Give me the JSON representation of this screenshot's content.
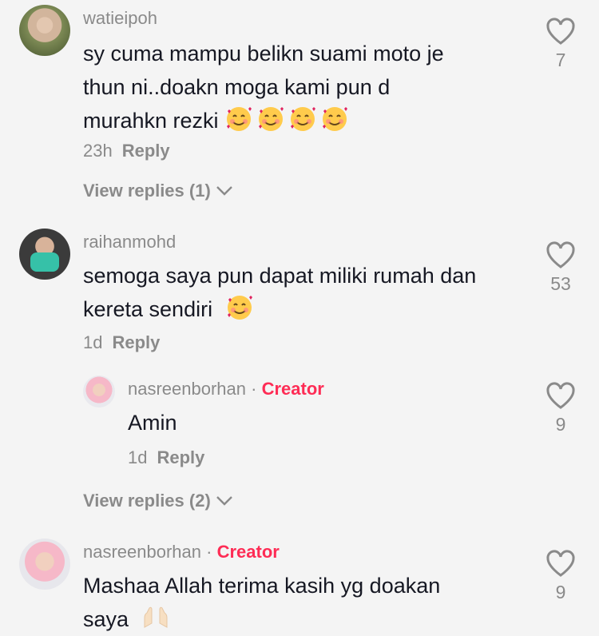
{
  "comments": [
    {
      "username": "watieipoh",
      "text_lines": [
        "sy cuma mampu belikn suami moto je",
        "thun ni..doakn moga kami pun d",
        "murahkn rezki"
      ],
      "time": "23h",
      "reply_label": "Reply",
      "likes": "7",
      "view_replies": "View replies (1)"
    },
    {
      "username": "raihanmohd",
      "text_lines": [
        "semoga saya pun dapat miliki rumah dan",
        "kereta sendiri"
      ],
      "time": "1d",
      "reply_label": "Reply",
      "likes": "53",
      "reply": {
        "username": "nasreenborhan",
        "separator": "·",
        "badge": "Creator",
        "text": "Amin",
        "time": "1d",
        "reply_label": "Reply",
        "likes": "9"
      },
      "view_replies": "View replies (2)"
    },
    {
      "username": "nasreenborhan",
      "separator": "·",
      "badge": "Creator",
      "text_lines": [
        "Mashaa Allah terima kasih yg doakan",
        "saya"
      ],
      "likes": "9"
    }
  ],
  "colors": {
    "accent": "#fe2c55",
    "muted": "#8a8a8a",
    "text": "#161823",
    "bg": "#f4f4f4"
  },
  "icons": [
    "heart-outline-icon",
    "chevron-down-icon",
    "smiling-face-with-hearts-emoji",
    "palms-up-together-emoji"
  ]
}
